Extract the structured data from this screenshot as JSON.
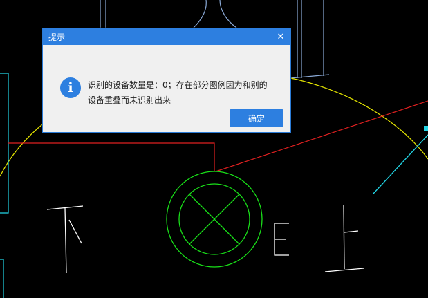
{
  "dialog": {
    "title": "提示",
    "close_icon": "close-icon",
    "info_icon": "info-icon",
    "info_glyph": "i",
    "message_line1": "识别的设备数量是：0；存在部分图例因为和别的",
    "message_line2": "设备重叠而未识别出来",
    "ok_label": "确定"
  },
  "drawing": {
    "label_xia": "下",
    "label_shang": "上",
    "label_e": "E",
    "colors": {
      "background": "#000000",
      "yellow": "#e6e600",
      "red": "#e02020",
      "green": "#19e019",
      "cyan": "#22d6e6",
      "white": "#ffffff",
      "steel": "#8aa9d6",
      "accent": "#2d7fe0"
    }
  }
}
